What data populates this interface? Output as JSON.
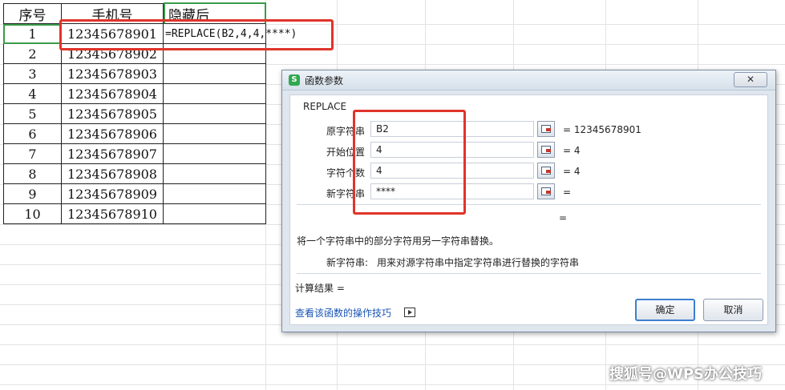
{
  "sheet": {
    "headers": [
      "序号",
      "手机号",
      "隐藏后"
    ],
    "rows": [
      {
        "idx": "1",
        "phone": "12345678901"
      },
      {
        "idx": "2",
        "phone": "12345678902"
      },
      {
        "idx": "3",
        "phone": "12345678903"
      },
      {
        "idx": "4",
        "phone": "12345678904"
      },
      {
        "idx": "5",
        "phone": "12345678905"
      },
      {
        "idx": "6",
        "phone": "12345678906"
      },
      {
        "idx": "7",
        "phone": "12345678907"
      },
      {
        "idx": "8",
        "phone": "12345678908"
      },
      {
        "idx": "9",
        "phone": "12345678909"
      },
      {
        "idx": "10",
        "phone": "12345678910"
      }
    ],
    "formula": "=REPLACE(B2,4,4,****)",
    "highlight_color": "#e0342b",
    "active_color": "#3a9a4a"
  },
  "dialog": {
    "title": "函数参数",
    "app_icon": "S",
    "close_label": "✕",
    "function_name": "REPLACE",
    "params": [
      {
        "label": "原字符串",
        "value": "B2",
        "result": "= 12345678901"
      },
      {
        "label": "开始位置",
        "value": "4",
        "result": "= 4"
      },
      {
        "label": "字符个数",
        "value": "4",
        "result": "= 4"
      },
      {
        "label": "新字符串",
        "value": "****",
        "result": "="
      }
    ],
    "formula_result_eq": "=",
    "description": "将一个字符串中的部分字符用另一字符串替换。",
    "param_help_label": "新字符串:",
    "param_help_text": "用来对源字符串中指定字符串进行替换的字符串",
    "calc_result_label": "计算结果 =",
    "help_link": "查看该函数的操作技巧",
    "ok_label": "确定",
    "cancel_label": "取消"
  },
  "watermark": "搜狐号@WPS办公技巧"
}
